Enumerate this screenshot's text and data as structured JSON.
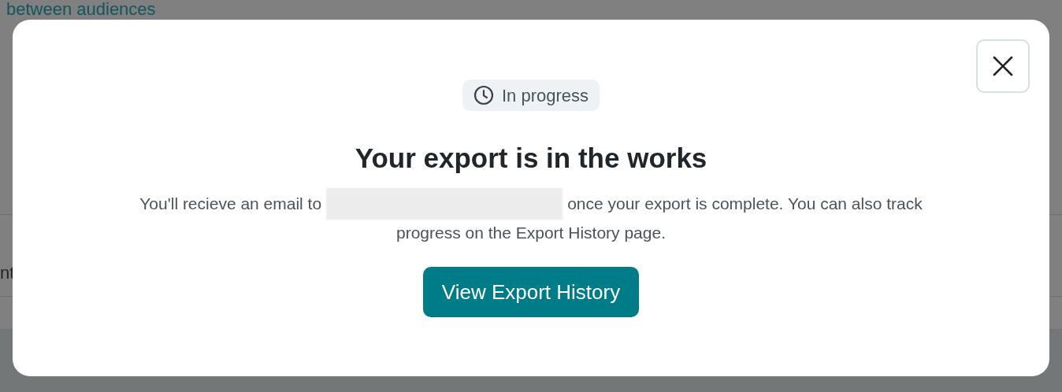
{
  "backdrop": {
    "heading": "between audiences",
    "fragments": [
      "nt"
    ]
  },
  "dialog": {
    "status": {
      "label": "In progress"
    },
    "title": "Your export is in the works",
    "message": {
      "before": "You'll recieve an email to",
      "email_redacted": true,
      "after": "once your export is complete. You can also track",
      "last_line": "progress on the Export History page."
    },
    "button": "View Export History"
  }
}
